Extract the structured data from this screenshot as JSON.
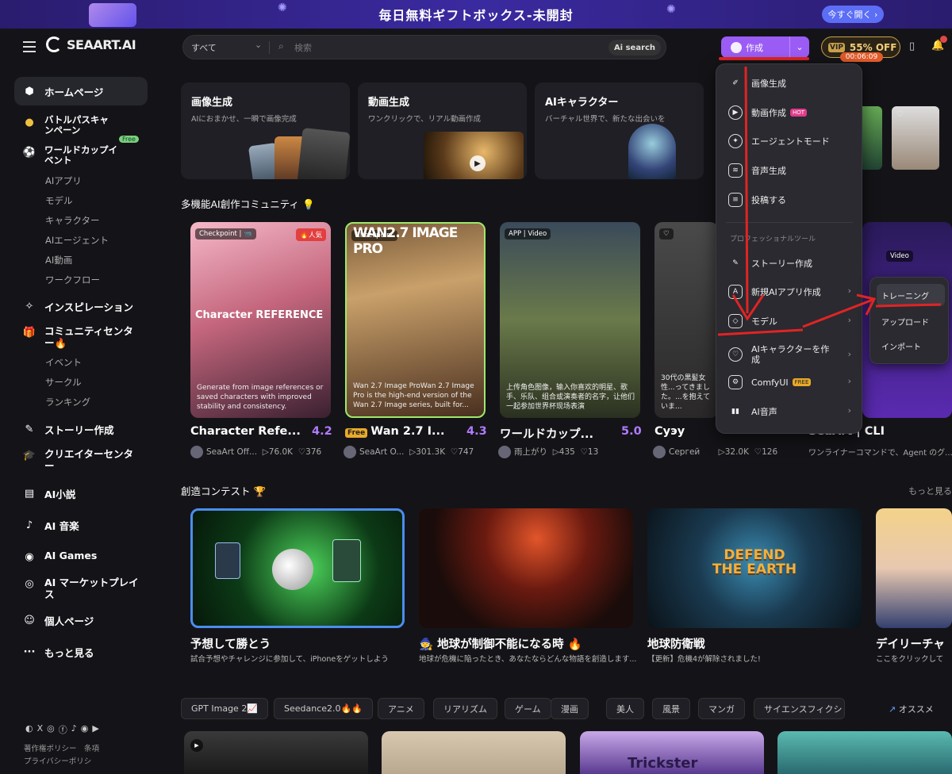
{
  "banner": {
    "title": "毎日無料ギフトボックス-未開封",
    "button": "今すぐ開く"
  },
  "header": {
    "logo": "SEAART.AI",
    "search_scope": "すべて",
    "search_placeholder": "検索",
    "ai_search": "Ai search",
    "create": "作成",
    "vip_badge": "VIP",
    "vip_offer": "55% OFF",
    "vip_timer": "00:06:09"
  },
  "sidebar": {
    "items": [
      {
        "label": "ホームページ",
        "icon": "home-icon"
      },
      {
        "label": "バトルパスキャンペーン",
        "icon": "coin-icon"
      },
      {
        "label": "ワールドカップイベント",
        "icon": "ball-icon",
        "badge": "Free"
      },
      {
        "label": "インスピレーション",
        "icon": "sparkle-icon"
      },
      {
        "label": "コミュニティセンター🔥",
        "icon": "gift-icon"
      },
      {
        "label": "ストーリー作成",
        "icon": "wand-icon"
      },
      {
        "label": "クリエイターセンター",
        "icon": "cap-icon"
      },
      {
        "label": "AI小説",
        "icon": "book-icon"
      },
      {
        "label": "AI 音楽",
        "icon": "music-icon"
      },
      {
        "label": "AI Games",
        "icon": "gamepad-icon"
      },
      {
        "label": "AI マーケットプレイス",
        "icon": "market-icon"
      },
      {
        "label": "個人ページ",
        "icon": "user-icon"
      },
      {
        "label": "もっと見る",
        "icon": "more-icon"
      }
    ],
    "sub1": [
      "AIアプリ",
      "モデル",
      "キャラクター",
      "AIエージェント",
      "AI動画",
      "ワークフロー"
    ],
    "sub2": [
      "イベント",
      "サークル",
      "ランキング"
    ],
    "footer1": "著作権ポリシー　条項",
    "footer2": "プライバシーポリシ"
  },
  "features": [
    {
      "title": "画像生成",
      "sub": "AIにおまかせ、一瞬で画像完成"
    },
    {
      "title": "動画生成",
      "sub": "ワンクリックで、リアル動画作成"
    },
    {
      "title": "AIキャラクター",
      "sub": "バーチャル世界で、新たな出会いを"
    }
  ],
  "community_title": "多機能AI創作コミュニティ 💡",
  "cards": [
    {
      "tag": "Checkpoint | 📹",
      "hot": "🔥人気",
      "big": "Character REFERENCE",
      "desc": "Generate from image references or saved characters with improved stability and consistency.",
      "title": "Character Refe...",
      "rating": "4.2",
      "author": "SeaArt Off...",
      "views": "▷76.0K",
      "likes": "♡376"
    },
    {
      "tag": "Checkpoint",
      "big": "WAN2.7 IMAGE PRO",
      "desc": "Wan 2.7 Image ProWan 2.7 Image Pro is the high-end version of the Wan 2.7 Image series, built for...",
      "free": "Free",
      "title": "Wan 2.7 I...",
      "rating": "4.3",
      "author": "SeaArt O...",
      "views": "▷301.3K",
      "likes": "♡747"
    },
    {
      "tag": "APP | Video",
      "desc": "上传角色图像，输入你喜欢的明星、歌手、乐队、组合或演奏者的名字，让他们一起参加世界杯现场表演",
      "title": "ワールドカップ...",
      "rating": "5.0",
      "author": "雨上がり",
      "views": "▷435",
      "likes": "♡13"
    },
    {
      "tag": "♡",
      "desc": "30代の黒髪女性...ってきました。...を抱えていま...",
      "title": "Суэу",
      "author": "Сергей",
      "views": "▷32.0K",
      "likes": "♡126"
    },
    {
      "tag": "Video",
      "title": "SeaArt | CLI",
      "author": "ワンライナーコマンドで、Agent のグ..."
    }
  ],
  "contest_title": "創造コンテスト 🏆",
  "more": "もっと見る",
  "contests": [
    {
      "title": "予想して勝とう",
      "sub": "試合予想やチャレンジに参加して、iPhoneをゲットしよう"
    },
    {
      "title": "🧙 地球が制御不能になる時 🔥",
      "sub": "地球が危機に陥ったとき、あなたならどんな物語を創造します..."
    },
    {
      "title": "地球防衛戦",
      "sub": "【更新】危機4が解除されました!"
    },
    {
      "title": "デイリーチャ",
      "sub": "ここをクリックして"
    }
  ],
  "earth_text": "DEFEND THE EARTH",
  "chips": [
    "GPT Image 2📈",
    "Seedance2.0🔥🔥",
    "アニメ",
    "リアリズム",
    "ゲーム",
    "漫画",
    "美人",
    "風景",
    "マンガ",
    "サイエンスフィクシ"
  ],
  "trending": "オススメ",
  "bottom_card_text": "Trickster",
  "dropdown": {
    "items": [
      {
        "label": "画像生成",
        "icon": "brush-icon"
      },
      {
        "label": "動画作成",
        "icon": "play-icon",
        "badge": "HOT"
      },
      {
        "label": "エージェントモード",
        "icon": "agent-icon"
      },
      {
        "label": "音声生成",
        "icon": "audio-icon"
      },
      {
        "label": "投稿する",
        "icon": "post-icon"
      }
    ],
    "header": "プロフェッショナルツール",
    "pro": [
      {
        "label": "ストーリー作成",
        "icon": "wand-icon"
      },
      {
        "label": "新規AIアプリ作成",
        "icon": "app-icon"
      },
      {
        "label": "モデル",
        "icon": "cube-icon"
      },
      {
        "label": "AIキャラクターを作成",
        "icon": "character-icon"
      },
      {
        "label": "ComfyUI",
        "icon": "comfy-icon",
        "badge": "FREE"
      },
      {
        "label": "AI音声",
        "icon": "voice-icon"
      }
    ]
  },
  "submenu": [
    "トレーニング",
    "アップロード",
    "インポート"
  ]
}
